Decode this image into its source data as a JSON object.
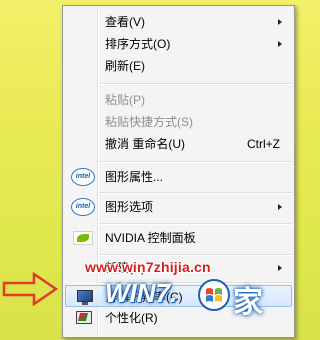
{
  "menu": {
    "items": [
      {
        "label": "查看(V)",
        "shortcut": "",
        "submenu": true,
        "disabled": false,
        "icon": ""
      },
      {
        "label": "排序方式(O)",
        "shortcut": "",
        "submenu": true,
        "disabled": false,
        "icon": ""
      },
      {
        "label": "刷新(E)",
        "shortcut": "",
        "submenu": false,
        "disabled": false,
        "icon": ""
      },
      {
        "label": "粘贴(P)",
        "shortcut": "",
        "submenu": false,
        "disabled": true,
        "icon": ""
      },
      {
        "label": "粘贴快捷方式(S)",
        "shortcut": "",
        "submenu": false,
        "disabled": true,
        "icon": ""
      },
      {
        "label": "撤消 重命名(U)",
        "shortcut": "Ctrl+Z",
        "submenu": false,
        "disabled": false,
        "icon": ""
      },
      {
        "label": "图形属性...",
        "shortcut": "",
        "submenu": false,
        "disabled": false,
        "icon": "intel-icon"
      },
      {
        "label": "图形选项",
        "shortcut": "",
        "submenu": true,
        "disabled": false,
        "icon": "intel-icon"
      },
      {
        "label": "NVIDIA 控制面板",
        "shortcut": "",
        "submenu": false,
        "disabled": false,
        "icon": "nvidia-icon"
      },
      {
        "label": "新建(X)",
        "shortcut": "",
        "submenu": true,
        "disabled": false,
        "icon": ""
      },
      {
        "label": "屏幕分辨率(C)",
        "shortcut": "",
        "submenu": false,
        "disabled": false,
        "icon": "monitor-icon",
        "highlighted": true
      },
      {
        "label": "个性化(R)",
        "shortcut": "",
        "submenu": false,
        "disabled": false,
        "icon": "personalize-icon"
      }
    ],
    "intel_icon_text": "intel"
  },
  "watermark": {
    "url": "www.win7zhijia.cn",
    "logo_text": "WIN7.",
    "logo_char": "家"
  },
  "colors": {
    "background": "#e9ea55",
    "menu_bg": "#f4f4f4",
    "highlight": "#d6e8fc",
    "watermark_red": "#d21f1f",
    "arrow_red": "#e03a2a"
  }
}
